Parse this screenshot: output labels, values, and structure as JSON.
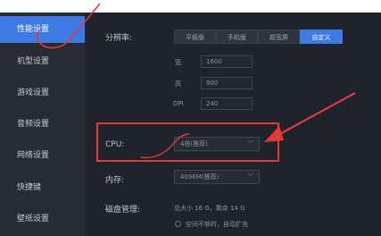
{
  "sidebar": {
    "items": [
      {
        "label": "性能设置"
      },
      {
        "label": "机型设置"
      },
      {
        "label": "游戏设置"
      },
      {
        "label": "音频设置"
      },
      {
        "label": "网络设置"
      },
      {
        "label": "快捷键"
      },
      {
        "label": "壁纸设置"
      }
    ]
  },
  "resolution": {
    "label": "分辨率:",
    "options": [
      "平板版",
      "手机版",
      "超宽屏",
      "自定义"
    ],
    "width_label": "宽",
    "width_value": "1600",
    "height_label": "高",
    "height_value": "900",
    "dpi_label": "DPI",
    "dpi_value": "240"
  },
  "cpu": {
    "label": "CPU:",
    "value": "4核(推荐)"
  },
  "memory": {
    "label": "内存:",
    "value": "4096M(推荐)"
  },
  "disk": {
    "label": "磁盘管理:",
    "info": "总大小 16 G，剩余 14 G",
    "option": "空间不够时，自动扩充"
  },
  "colors": {
    "accent": "#3d7be4",
    "annotation": "#e53935"
  }
}
